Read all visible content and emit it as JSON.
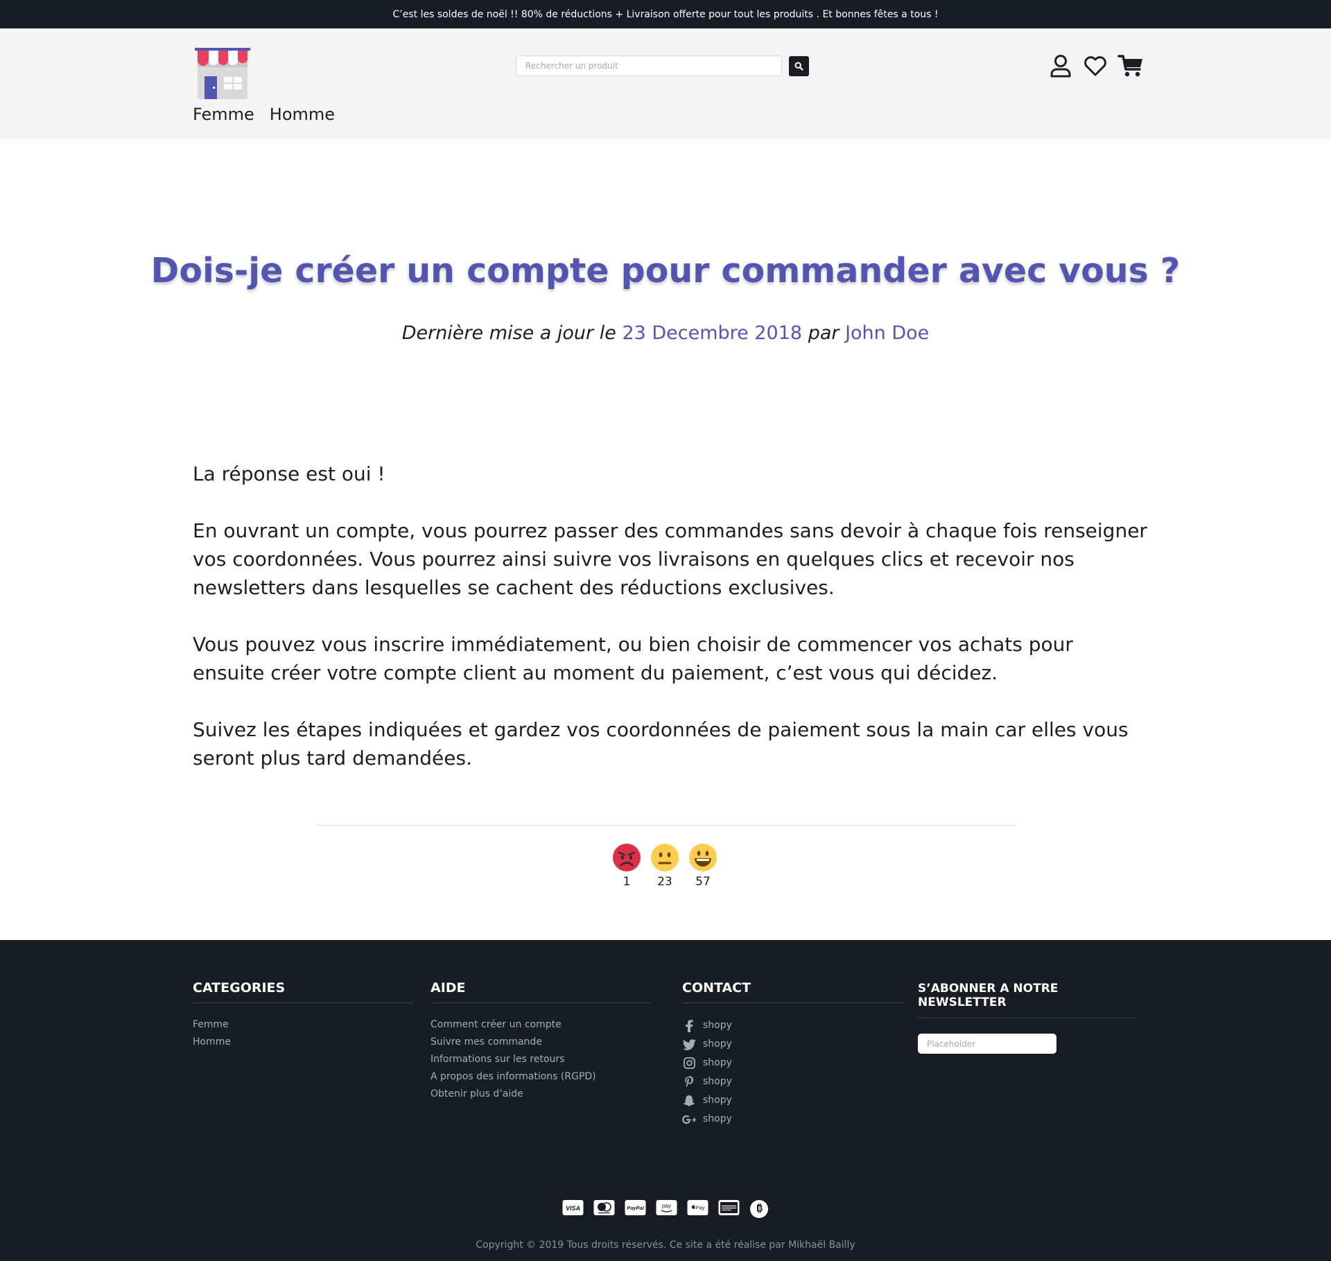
{
  "topbar": {
    "promo": "C’est les soldes de noël !! 80% de réductions + Livraison offerte pour tout les produits . Et bonnes fêtes a tous !"
  },
  "header": {
    "logo_icon": "store-icon",
    "nav": [
      "Femme",
      "Homme"
    ],
    "search": {
      "placeholder": "Rechercher un produit",
      "value": "",
      "button_icon": "search-icon"
    },
    "icons": [
      "user-icon",
      "heart-icon",
      "cart-icon"
    ]
  },
  "article": {
    "title": "Dois-je créer un compte pour commander avec vous ?",
    "meta": {
      "prefix": "Dernière mise a jour le",
      "date": "23 Decembre 2018",
      "by": "par",
      "author": "John Doe"
    },
    "paragraphs": [
      "La réponse est oui !",
      "En ouvrant un compte, vous pourrez passer des commandes sans devoir à chaque fois renseigner vos coordonnées. Vous pourrez ainsi suivre vos livraisons en quelques clics et recevoir nos newsletters dans lesquelles se cachent des réductions exclusives.",
      "Vous pouvez vous inscrire immédiatement, ou bien choisir de commencer vos achats pour ensuite créer votre compte client au moment du paiement, c’est vous qui décidez.",
      "Suivez les étapes indiquées et gardez vos coordonnées de paiement sous la main car elles vous seront  plus tard demandées."
    ],
    "reactions": [
      {
        "icon": "angry-face-icon",
        "count": "1",
        "color": "#dd2e44"
      },
      {
        "icon": "neutral-face-icon",
        "count": "23",
        "color": "#ffcc4d"
      },
      {
        "icon": "grinning-face-icon",
        "count": "57",
        "color": "#ffcc4d"
      }
    ]
  },
  "footer": {
    "categories": {
      "title": "CATEGORIES",
      "items": [
        "Femme",
        "Homme"
      ]
    },
    "aide": {
      "title": "AIDE",
      "items": [
        "Comment créer un compte",
        "Suivre mes commande",
        "Informations sur les retours",
        "A propos des informations (RGPD)",
        "Obtenir plus d’aide"
      ]
    },
    "contact": {
      "title": "CONTACT",
      "items": [
        {
          "icon": "facebook-icon",
          "label": "shopy"
        },
        {
          "icon": "twitter-icon",
          "label": "shopy"
        },
        {
          "icon": "instagram-icon",
          "label": "shopy"
        },
        {
          "icon": "pinterest-icon",
          "label": "shopy"
        },
        {
          "icon": "snapchat-icon",
          "label": "shopy"
        },
        {
          "icon": "google-plus-icon",
          "label": "shopy"
        }
      ]
    },
    "newsletter": {
      "title": "S’ABONNER A NOTRE NEWSLETTER",
      "placeholder": "Placeholder"
    },
    "payments": [
      "visa-icon",
      "mastercard-icon",
      "paypal-icon",
      "amazon-pay-icon",
      "apple-pay-icon",
      "amex-icon",
      "bitcoin-icon"
    ],
    "payment_labels": {
      "visa": "VISA",
      "paypal": "PayPal",
      "amazon": "pay",
      "apple": "Pay"
    },
    "copyright": "Copyright © 2019 Tous droits réservés. Ce site a été réalise par Mikhaël Bailly"
  },
  "colors": {
    "accent": "#5355b2",
    "dark": "#181d25",
    "header_bg": "#f4f4f4",
    "logo_red": "#e8415f"
  }
}
